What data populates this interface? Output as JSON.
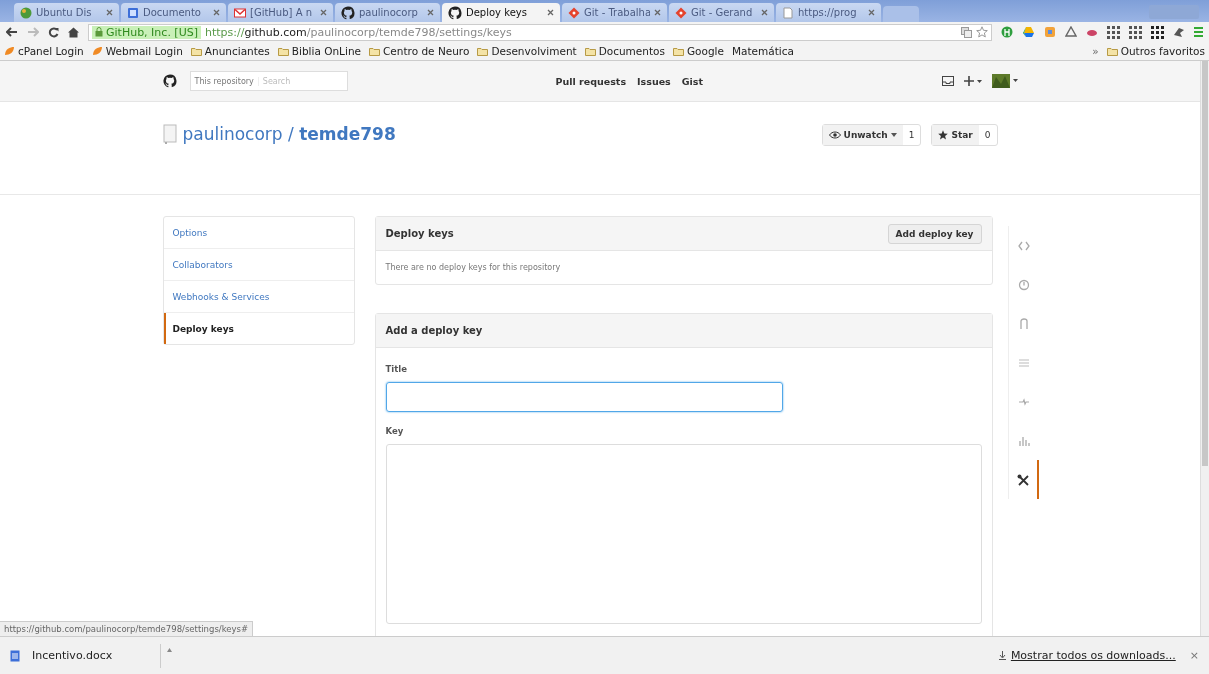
{
  "browser": {
    "tabs": [
      {
        "title": "Ubuntu Dis",
        "kind": "ubuntu",
        "selected": false
      },
      {
        "title": "Documento",
        "kind": "docs",
        "selected": false
      },
      {
        "title": "[GitHub] A n",
        "kind": "mail",
        "selected": false
      },
      {
        "title": "paulinocorp",
        "kind": "github",
        "selected": false
      },
      {
        "title": "Deploy keys",
        "kind": "github",
        "selected": true
      },
      {
        "title": "Git - Trabalha",
        "kind": "git",
        "selected": false
      },
      {
        "title": "Git - Gerand",
        "kind": "git",
        "selected": false
      },
      {
        "title": "https://prog",
        "kind": "page",
        "selected": false
      }
    ],
    "security_label": "GitHub, Inc. [US]",
    "url_scheme": "https://",
    "url_host": "github.com",
    "url_path": "/paulinocorp/temde798/settings/keys",
    "bookmarks": [
      {
        "label": "cPanel Login",
        "kind": "cpanel"
      },
      {
        "label": "Webmail Login",
        "kind": "cpanel"
      },
      {
        "label": "Anunciantes",
        "kind": "folder"
      },
      {
        "label": "Biblia OnLine",
        "kind": "folder"
      },
      {
        "label": "Centro de Neuro",
        "kind": "folder"
      },
      {
        "label": "Desenvolviment",
        "kind": "folder"
      },
      {
        "label": "Documentos",
        "kind": "folder"
      },
      {
        "label": "Google",
        "kind": "folder"
      },
      {
        "label": "Matemática",
        "kind": "text"
      }
    ],
    "bookmarks_more": "»",
    "other_bookmarks": "Outros favoritos"
  },
  "github_header": {
    "search_scope": "This repository",
    "search_placeholder": "Search",
    "nav": [
      "Pull requests",
      "Issues",
      "Gist"
    ]
  },
  "repo": {
    "owner": "paulinocorp",
    "separator": "/",
    "name": "temde798",
    "watch": {
      "label": "Unwatch",
      "count": "1"
    },
    "star": {
      "label": "Star",
      "count": "0"
    }
  },
  "settings_menu": [
    {
      "label": "Options",
      "selected": false
    },
    {
      "label": "Collaborators",
      "selected": false
    },
    {
      "label": "Webhooks & Services",
      "selected": false
    },
    {
      "label": "Deploy keys",
      "selected": true
    }
  ],
  "deploy_keys": {
    "title": "Deploy keys",
    "add_button": "Add deploy key",
    "empty_message": "There are no deploy keys for this repository"
  },
  "add_key_form": {
    "title": "Add a deploy key",
    "fields": [
      {
        "label": "Title",
        "kind": "input",
        "focused": true
      },
      {
        "label": "Key",
        "kind": "textarea",
        "focused": false
      }
    ]
  },
  "repo_nav": [
    {
      "kind": "code",
      "selected": false
    },
    {
      "kind": "issue",
      "selected": false
    },
    {
      "kind": "pull",
      "selected": false
    },
    {
      "kind": "wiki",
      "selected": false
    },
    {
      "kind": "pulse",
      "selected": false
    },
    {
      "kind": "graphs",
      "selected": false
    },
    {
      "kind": "settings",
      "selected": true
    }
  ],
  "status_url": "https://github.com/paulinocorp/temde798/settings/keys#",
  "downloads": {
    "items": [
      {
        "name": "Incentivo.docx"
      }
    ],
    "show_all": "Mostrar todos os downloads...",
    "close": "×"
  }
}
